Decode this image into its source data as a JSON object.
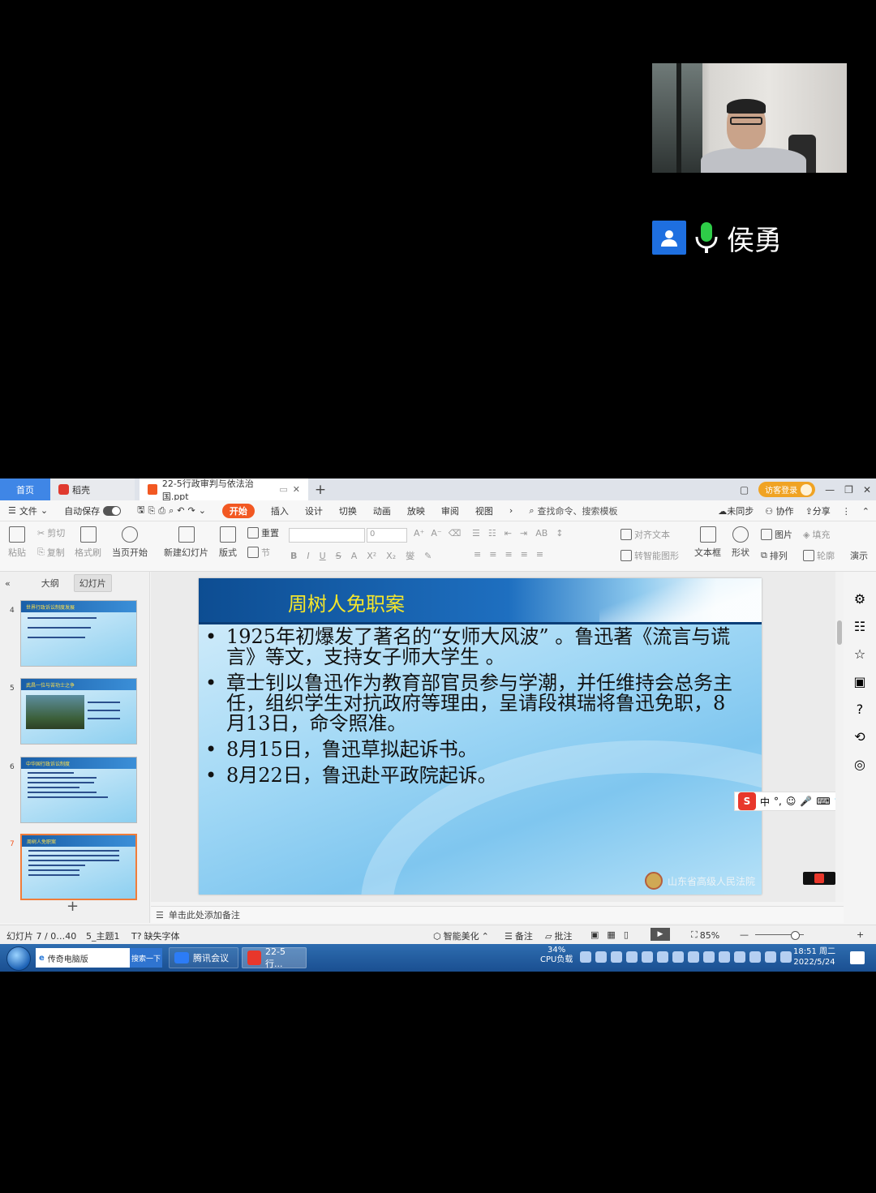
{
  "meeting": {
    "speaker_name": "侯勇"
  },
  "tabs": {
    "home": "首页",
    "daoke": "稻壳",
    "document": "22-5行政审判与依法治国.ppt",
    "visitor_login": "访客登录"
  },
  "menu": {
    "file": "文件",
    "autosave": "自动保存",
    "items": [
      "开始",
      "插入",
      "设计",
      "切换",
      "动画",
      "放映",
      "审阅",
      "视图"
    ],
    "search": "查找命令、搜索模板",
    "unsynced": "未同步",
    "collaborate": "协作",
    "share": "分享"
  },
  "ribbon": {
    "paste": "粘贴",
    "cut": "剪切",
    "copy": "复制",
    "format_painter": "格式刷",
    "from_current": "当页开始",
    "new_slide": "新建幻灯片",
    "layout": "版式",
    "reset": "重置",
    "section": "节",
    "font_size": "0",
    "align_text": "对齐文本",
    "smart_shape": "转智能图形",
    "textbox": "文本框",
    "shape": "形状",
    "picture": "图片",
    "arrange": "排列",
    "fill": "填充",
    "outline": "轮廓",
    "present": "演示"
  },
  "left_pane": {
    "tab_outline": "大纲",
    "tab_slides": "幻灯片",
    "thumbs": [
      {
        "num": "4",
        "title": "世界行政诉讼制度发展"
      },
      {
        "num": "5",
        "title": "武昌一位与苦功士之争"
      },
      {
        "num": "6",
        "title": "中华国行政诉讼制度"
      },
      {
        "num": "7",
        "title": "周树人免职案"
      }
    ]
  },
  "slide": {
    "title": "周树人免职案",
    "bullets": [
      "1925年初爆发了著名的“女师大风波”    。鲁迅著《流言与谎言》等文，支持女子师大学生  。",
      "章士钊以鲁迅作为教育部官员参与学潮，并任维持会总务主任，组织学生对抗政府等理由，呈请段祺瑞将鲁迅免职，8月13日，命令照准。",
      "8月15日，鲁迅草拟起诉书。",
      "8月22日，鲁迅赴平政院起诉。"
    ],
    "footer_logo": "山东省高级人民法院"
  },
  "ime": {
    "mode": "中"
  },
  "notes": {
    "placeholder": "单击此处添加备注"
  },
  "status": {
    "slide_pos": "幻灯片 7 / 0…40",
    "theme": "5_主题1",
    "missing_font": "缺失字体",
    "beautify": "智能美化",
    "notes": "备注",
    "comments": "批注",
    "zoom": "85%"
  },
  "taskbar": {
    "browser": "传奇电脑版",
    "search_btn": "搜索一下",
    "meeting": "腾讯会议",
    "wps": "22-5行...",
    "cpu_pct": "34%",
    "cpu_label": "CPU负载",
    "time": "18:51 周二",
    "date": "2022/5/24"
  }
}
